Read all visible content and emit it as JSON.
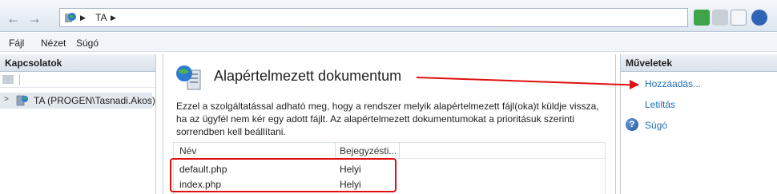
{
  "address_bar": {
    "crumb": "TA"
  },
  "menu": {
    "items": [
      "Fájl",
      "Nézet",
      "Súgó"
    ]
  },
  "connections": {
    "header": "Kapcsolatok",
    "tree_item": "TA (PROGEN\\Tasnadi.Akos)"
  },
  "feature": {
    "title": "Alapértelmezett dokumentum",
    "description": "Ezzel a szolgáltatással adható meg, hogy a rendszer melyik alapértelmezett fájl(oka)t küldje vissza, ha az ügyfél nem kér egy adott fájlt. Az alapértelmezett dokumentumokat a prioritásuk szerinti sorrendben kell beállítani.",
    "columns": [
      "Név",
      "Bejegyzésti..."
    ],
    "rows": [
      {
        "name": "default.php",
        "entry": "Helyi"
      },
      {
        "name": "index.php",
        "entry": "Helyi"
      }
    ]
  },
  "actions": {
    "header": "Műveletek",
    "items": [
      "Hozzáadás...",
      "Letiltás",
      "Súgó"
    ]
  },
  "colors": {
    "annotation": "#e01010",
    "link": "#1f6fb2"
  },
  "icons": [
    "back-icon",
    "forward-icon",
    "globe-icon",
    "refresh-icon",
    "stop-icon",
    "home-icon",
    "help-icon"
  ]
}
